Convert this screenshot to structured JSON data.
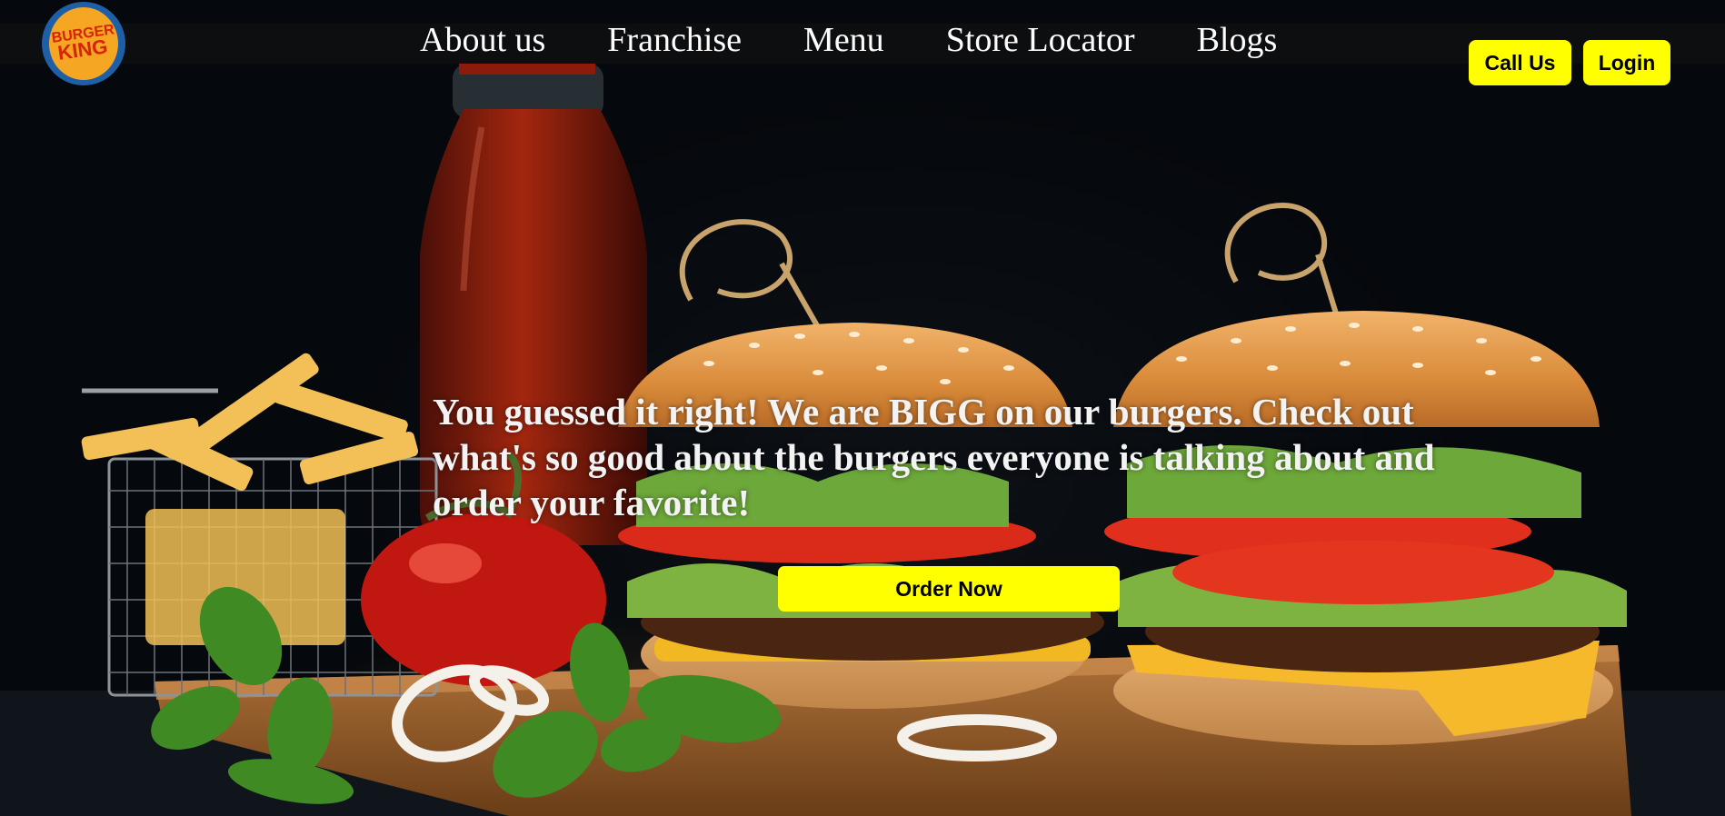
{
  "brand": {
    "logo_line1": "BURGER",
    "logo_line2": "KING",
    "colors": {
      "bun": "#f5a623",
      "red": "#d62300",
      "blue": "#1f5fa8"
    }
  },
  "nav": {
    "links": [
      "About us",
      "Franchise",
      "Menu",
      "Store Locator",
      "Blogs"
    ]
  },
  "actions": {
    "call_label": "Call Us",
    "login_label": "Login"
  },
  "hero": {
    "headline": "You guessed it right! We are BIGG on our burgers. Check out what's so good about the burgers everyone is talking about and order your favorite!",
    "cta_label": "Order Now",
    "accent_color": "#ffff00"
  }
}
